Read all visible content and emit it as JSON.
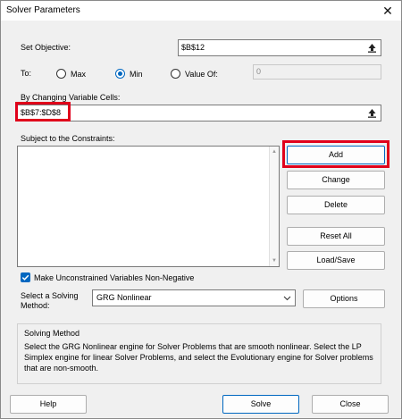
{
  "window": {
    "title": "Solver Parameters",
    "close_glyph": "✕"
  },
  "objective": {
    "label": "Set Objective:",
    "value": "$B$12"
  },
  "to": {
    "label": "To:",
    "options": [
      {
        "label": "Max",
        "selected": false
      },
      {
        "label": "Min",
        "selected": true
      },
      {
        "label": "Value Of:",
        "selected": false
      }
    ],
    "value_of": "0"
  },
  "changing": {
    "label": "By Changing Variable Cells:",
    "value": "$B$7:$D$8"
  },
  "constraints": {
    "label": "Subject to the Constraints:",
    "items": []
  },
  "buttons": {
    "add": "Add",
    "change": "Change",
    "delete": "Delete",
    "reset_all": "Reset All",
    "load_save": "Load/Save",
    "options": "Options",
    "help": "Help",
    "solve": "Solve",
    "close": "Close"
  },
  "nonneg": {
    "label": "Make Unconstrained Variables Non-Negative",
    "checked": true
  },
  "method": {
    "label_line1": "Select a Solving",
    "label_line2": "Method:",
    "selected": "GRG Nonlinear"
  },
  "solving_method": {
    "heading": "Solving Method",
    "text": "Select the GRG Nonlinear engine for Solver Problems that are smooth nonlinear. Select the LP Simplex engine for linear Solver Problems, and select the Evolutionary engine for Solver problems that are non-smooth."
  },
  "colors": {
    "accent": "#0067c0",
    "highlight": "#e0001b"
  },
  "icons": [
    "close-icon",
    "collapse-dialog-icon",
    "dropdown-chevron-icon",
    "checkmark-icon"
  ]
}
